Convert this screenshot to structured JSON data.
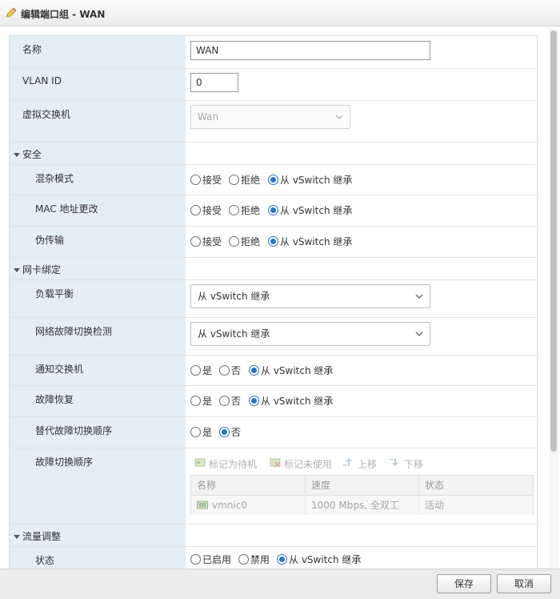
{
  "window": {
    "title": "编辑端口组 - WAN"
  },
  "fields": {
    "name": {
      "label": "名称",
      "value": "WAN"
    },
    "vlan": {
      "label": "VLAN ID",
      "value": "0"
    },
    "vswitch": {
      "label": "虚拟交换机",
      "value": "Wan"
    }
  },
  "security": {
    "title": "安全",
    "rows": [
      {
        "label": "混杂模式",
        "options": [
          "接受",
          "拒绝",
          "从 vSwitch 继承"
        ],
        "selected": 2
      },
      {
        "label": "MAC 地址更改",
        "options": [
          "接受",
          "拒绝",
          "从 vSwitch 继承"
        ],
        "selected": 2
      },
      {
        "label": "伪传输",
        "options": [
          "接受",
          "拒绝",
          "从 vSwitch 继承"
        ],
        "selected": 2
      }
    ]
  },
  "nic_teaming": {
    "title": "网卡绑定",
    "load_balancing": {
      "label": "负载平衡",
      "value": "从 vSwitch 继承"
    },
    "failure_detection": {
      "label": "网络故障切换检测",
      "value": "从 vSwitch 继承"
    },
    "notify_switches": {
      "label": "通知交换机",
      "options": [
        "是",
        "否",
        "从 vSwitch 继承"
      ],
      "selected": 2
    },
    "failback": {
      "label": "故障恢复",
      "options": [
        "是",
        "否",
        "从 vSwitch 继承"
      ],
      "selected": 2
    },
    "override_failover": {
      "label": "替代故障切换顺序",
      "options": [
        "是",
        "否"
      ],
      "selected": 1
    },
    "failover_order": {
      "label": "故障切换顺序",
      "toolbar": [
        "标记为待机",
        "标记未使用",
        "上移",
        "下移"
      ],
      "columns": [
        "名称",
        "速度",
        "状态"
      ],
      "rows": [
        {
          "name": "vmnic0",
          "speed": "1000 Mbps, 全双工",
          "status": "活动"
        }
      ]
    }
  },
  "traffic_shaping": {
    "title": "流量调整",
    "status": {
      "label": "状态",
      "options": [
        "已启用",
        "禁用",
        "从 vSwitch 继承"
      ],
      "selected": 2
    }
  },
  "footer": {
    "save": "保存",
    "cancel": "取消"
  },
  "colors": {
    "label_bg": "#e3eef5",
    "radio_accent": "#2a74c4"
  }
}
